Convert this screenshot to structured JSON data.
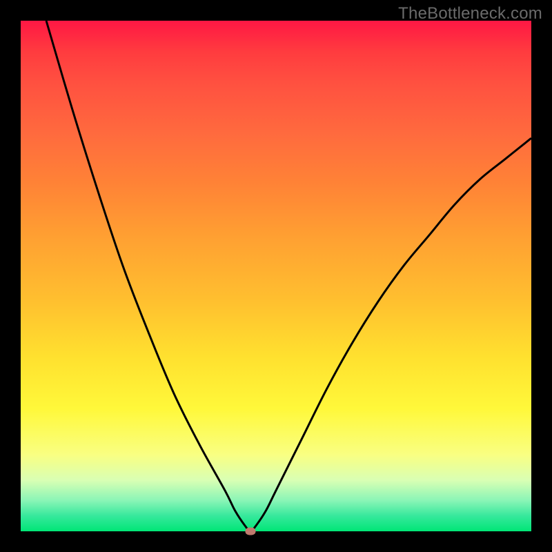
{
  "watermark": "TheBottleneck.com",
  "colors": {
    "frame": "#000000",
    "curve": "#000000",
    "marker": "#bf7a6e",
    "gradient_top": "#ff1744",
    "gradient_bottom": "#00e676"
  },
  "chart_data": {
    "type": "line",
    "title": "",
    "xlabel": "",
    "ylabel": "",
    "xlim": [
      0,
      100
    ],
    "ylim": [
      0,
      100
    ],
    "x": [
      5,
      10,
      15,
      20,
      25,
      30,
      35,
      40,
      42,
      44,
      45,
      46,
      48,
      50,
      55,
      60,
      65,
      70,
      75,
      80,
      85,
      90,
      95,
      100
    ],
    "y": [
      100,
      83,
      67,
      52,
      39,
      27,
      17,
      8,
      4,
      1,
      0,
      1,
      4,
      8,
      18,
      28,
      37,
      45,
      52,
      58,
      64,
      69,
      73,
      77
    ],
    "series": [
      {
        "name": "bottleneck-curve",
        "x_key": "x",
        "y_key": "y"
      }
    ],
    "marker": {
      "x": 45,
      "y": 0
    },
    "annotations": []
  }
}
